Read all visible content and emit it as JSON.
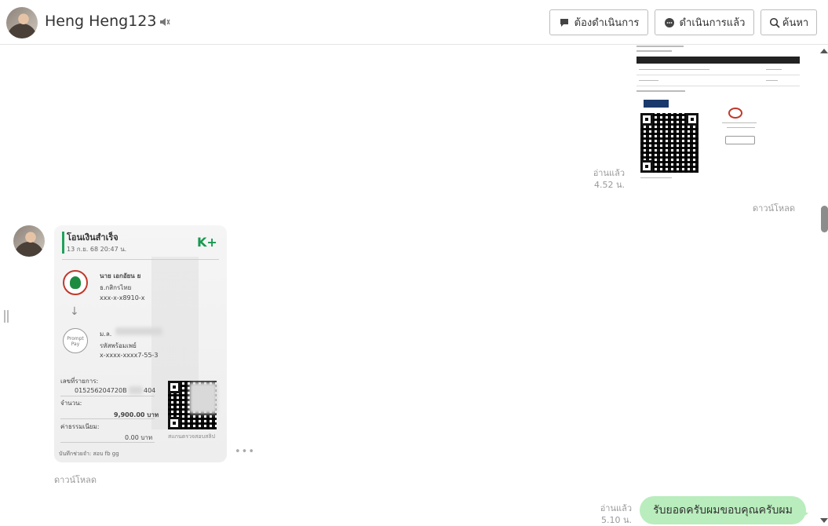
{
  "header": {
    "contact_name": "Heng Heng123",
    "mute_icon": "mute-speaker-icon",
    "buttons": {
      "todo_label": "ต้องดำเนินการ",
      "done_label": "ดำเนินการแล้ว",
      "search_label": "ค้นหา"
    }
  },
  "messages": {
    "invoice": {
      "read_label": "อ่านแล้ว",
      "time": "4.52 น.",
      "download_label": "ดาวน์โหลด"
    },
    "slip": {
      "title": "โอนเงินสำเร็จ",
      "date": "13 ก.ย. 68  20:47 น.",
      "brand": "K+",
      "sender_name": "นาย เอกอัยน ย",
      "sender_bank": "ธ.กสิกรไทย",
      "sender_account": "xxx-x-x8910-x",
      "receiver_name": "ม.ล.",
      "receiver_type": "รหัสพร้อมเพย์",
      "receiver_account": "x-xxxx-xxxx7-55-3",
      "ref_label": "เลขที่รายการ:",
      "ref_value": "015256204720B",
      "ref_suffix": "404",
      "amount_label": "จำนวน:",
      "amount_value": "9,900.00 บาท",
      "fee_label": "ค่าธรรมเนียม:",
      "fee_value": "0.00 บาท",
      "scan_text": "สแกนตรวจสอบสลิป",
      "memo": "บันทึกช่วยจำ: สอบ fb gg",
      "download_label": "ดาวน์โหลด",
      "promptpay_label": "Prompt Pay"
    },
    "reply": {
      "read_label": "อ่านแล้ว",
      "time": "5.10 น.",
      "text": "รับยอดครับผมขอบคุณครับผม"
    }
  },
  "colors": {
    "bubble": "#b9edbd",
    "kplus_green": "#17994f"
  }
}
